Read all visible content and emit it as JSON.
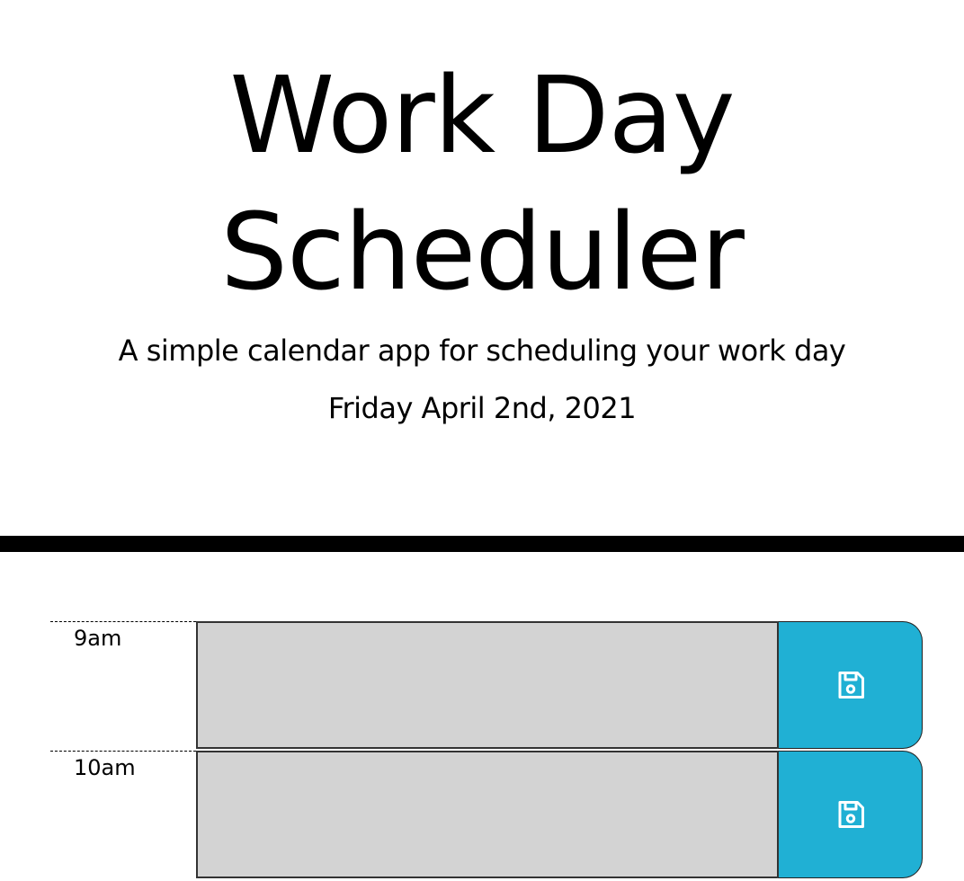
{
  "header": {
    "title": "Work Day Scheduler",
    "subtitle": "A simple calendar app for scheduling your work day",
    "current_day": "Friday April 2nd, 2021"
  },
  "time_blocks": [
    {
      "hour": "9am",
      "text": "",
      "save_icon": "save-icon"
    },
    {
      "hour": "10am",
      "text": "",
      "save_icon": "save-icon"
    }
  ],
  "colors": {
    "past_block": "#d3d3d3",
    "save_button": "#20b0d4",
    "divider": "#000000"
  }
}
